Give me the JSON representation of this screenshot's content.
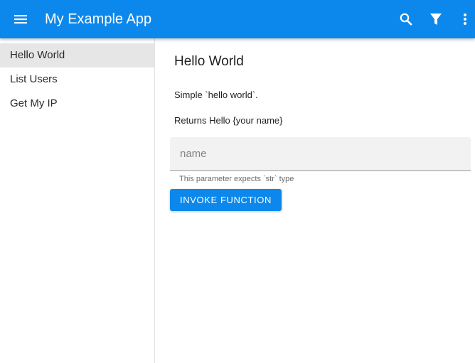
{
  "appbar": {
    "title": "My Example App",
    "menu_icon": "hamburger-menu-icon",
    "actions": [
      "search-icon",
      "filter-icon",
      "more-vert-icon"
    ],
    "color": "#0c88ec"
  },
  "sidebar": {
    "items": [
      {
        "label": "Hello World",
        "active": true
      },
      {
        "label": "List Users",
        "active": false
      },
      {
        "label": "Get My IP",
        "active": false
      }
    ]
  },
  "main": {
    "title": "Hello World",
    "description": "Simple `hello world`.",
    "returns": "Returns Hello {your name}",
    "field": {
      "placeholder": "name",
      "value": "",
      "hint": "This parameter expects `str` type"
    },
    "invoke_label": "INVOKE FUNCTION"
  }
}
